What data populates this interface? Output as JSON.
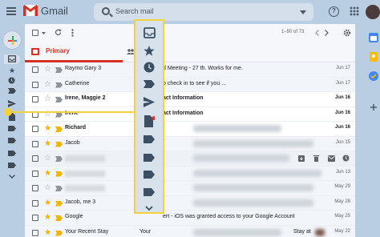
{
  "app": {
    "name": "Gmail",
    "search_placeholder": "Search mail",
    "help_glyph": "?",
    "pager": "1–50 of 73"
  },
  "tabs": {
    "primary_label": "Primary"
  },
  "colors": {
    "accent": "#d93025",
    "callout": "#f5d23a",
    "star": "#f4b400"
  },
  "emails": [
    {
      "sender": "Raymo  Gary 3",
      "subject": "d Meeting - 27 th. Works for me.",
      "date": "Jun 17",
      "starred": false,
      "important": false,
      "unread": false
    },
    {
      "sender": "Catherine",
      "subject": "o check in to see if you ...",
      "date": "Jun 17",
      "starred": false,
      "important": false,
      "unread": false
    },
    {
      "sender": "Irene, Maggie 2",
      "subject": "act Information",
      "date": "Jun 16",
      "starred": false,
      "important": false,
      "unread": true
    },
    {
      "sender": "Irene",
      "subject": "act Information",
      "date": "Jun 16",
      "starred": false,
      "important": false,
      "unread": true
    },
    {
      "sender": "Richard",
      "subject": "",
      "date": "Jun 16",
      "starred": true,
      "important": true,
      "unread": true
    },
    {
      "sender": "Jacob",
      "subject": "",
      "date": "Jun 15",
      "starred": true,
      "important": true,
      "unread": false
    },
    {
      "sender": "",
      "subject": "",
      "date": "",
      "starred": false,
      "important": false,
      "unread": false,
      "hover": true
    },
    {
      "sender": "",
      "subject": "",
      "date": "Jun 13",
      "starred": true,
      "important": true,
      "unread": false
    },
    {
      "sender": "",
      "subject": "",
      "date": "May 29",
      "starred": false,
      "important": false,
      "unread": false
    },
    {
      "sender": "Jacob, me 3",
      "subject": "",
      "date": "May 28",
      "starred": true,
      "important": true,
      "unread": false
    },
    {
      "sender": "Google",
      "subject": "ert - iOS was granted access to your Google Account",
      "date": "May 25",
      "starred": true,
      "important": true,
      "unread": false
    },
    {
      "sender": "Your Recent Stay",
      "subject": "Your",
      "subject2": "Stay at",
      "date": "May 22",
      "starred": true,
      "important": true,
      "unread": false
    }
  ],
  "popover_icons": [
    "inbox-icon",
    "star-icon",
    "clock-icon",
    "important-icon",
    "send-icon",
    "draft-icon",
    "label-icon",
    "label-icon",
    "label-icon",
    "label-icon",
    "chevron-down-icon"
  ]
}
